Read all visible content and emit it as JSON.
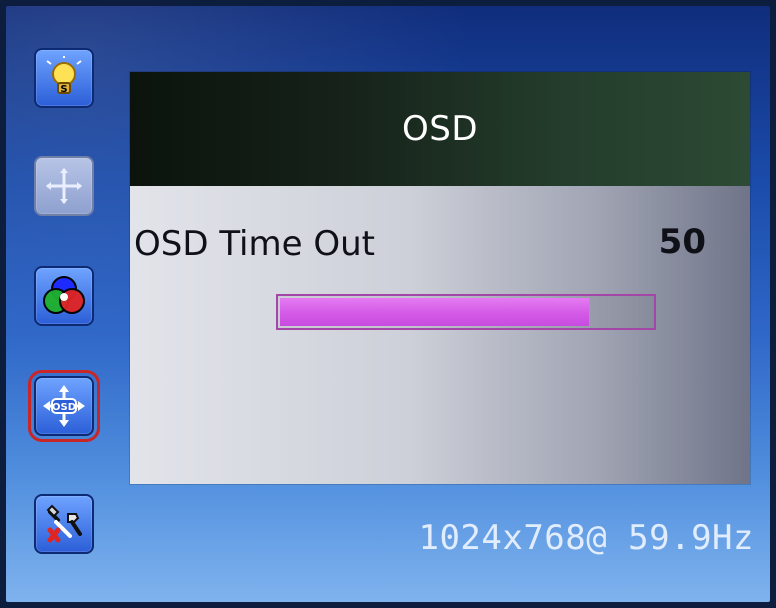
{
  "menu": {
    "items": [
      {
        "name": "brightness",
        "icon": "lightbulb-icon"
      },
      {
        "name": "position",
        "icon": "move-icon",
        "state": "disabled"
      },
      {
        "name": "color",
        "icon": "color-wheel-icon"
      },
      {
        "name": "osd",
        "icon": "osd-icon",
        "state": "selected"
      },
      {
        "name": "setup",
        "icon": "tools-icon"
      }
    ]
  },
  "panel": {
    "title": "OSD",
    "setting": {
      "label": "OSD Time Out",
      "value": "50",
      "fill_fraction": 0.83
    }
  },
  "status": {
    "resolution": "1024x768@ 59.9Hz"
  },
  "colors": {
    "progress_fill": "#d35ae6",
    "selected_outline": "#c92626"
  }
}
